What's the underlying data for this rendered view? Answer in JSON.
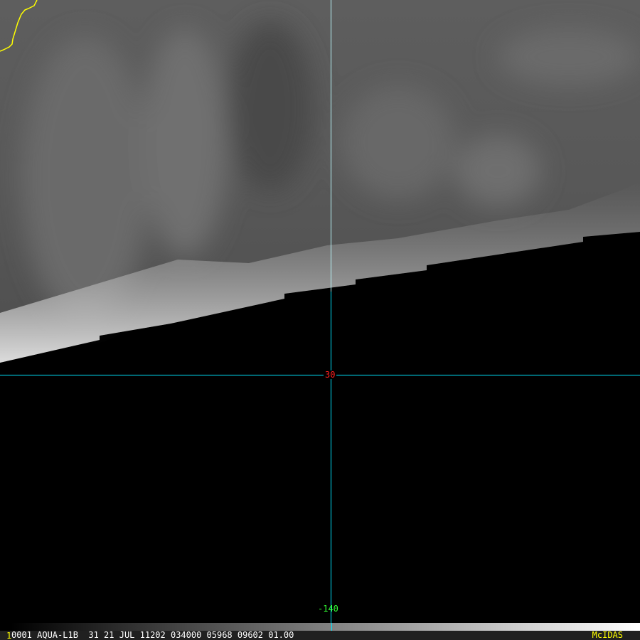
{
  "image": {
    "lat_label": "30",
    "lon_label": "-140",
    "colors": {
      "coastline": "#ffff00",
      "grid": "#00e5ff",
      "lat_text": "#ff2020",
      "lon_text": "#33ff33"
    }
  },
  "status": {
    "frame": "1",
    "text": "0001 AQUA-L1B  31 21 JUL 11202 034000 05968 09602 01.00",
    "brand": "McIDAS"
  }
}
